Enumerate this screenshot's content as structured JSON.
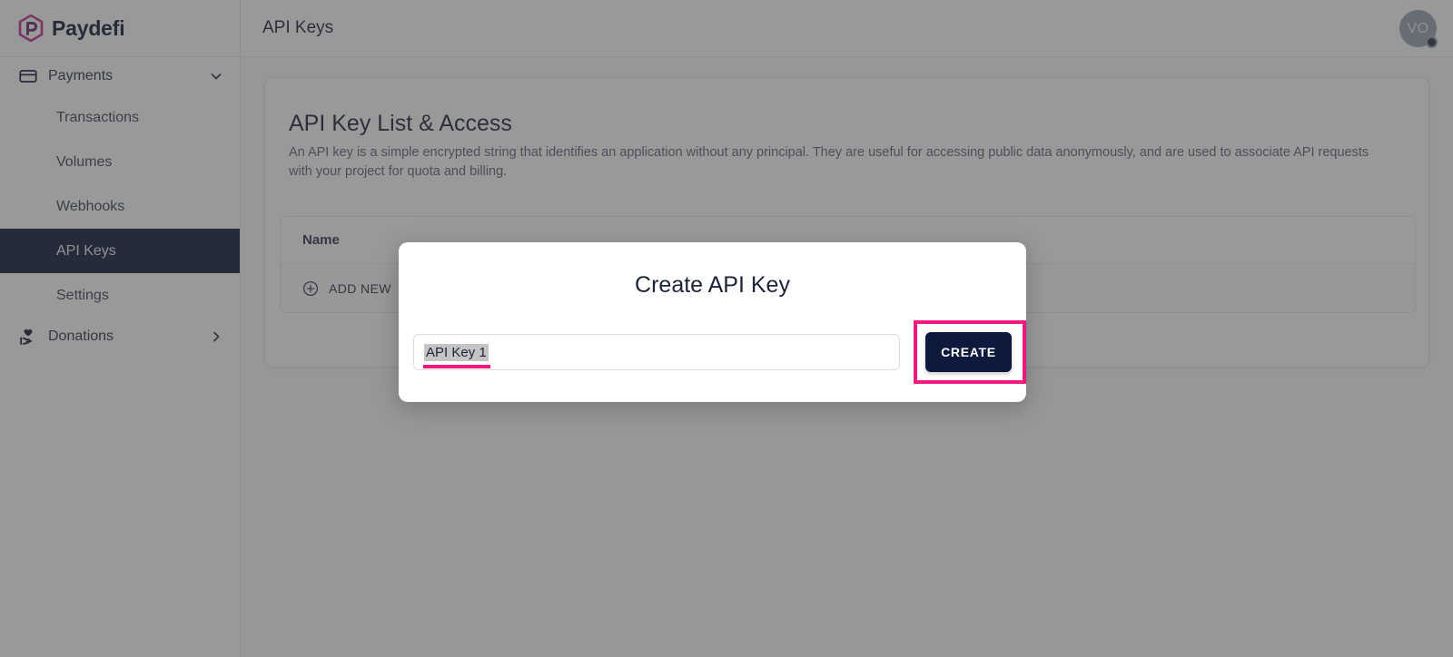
{
  "brand": {
    "name": "Paydefi",
    "logo_icon": "paydefi-hexagon-logo",
    "accent": "#c2308c"
  },
  "sidebar": {
    "group": {
      "label": "Payments",
      "icon": "credit-card-icon",
      "chevron": "chevron-down-icon",
      "expanded": true,
      "items": [
        {
          "label": "Transactions",
          "active": false
        },
        {
          "label": "Volumes",
          "active": false
        },
        {
          "label": "Webhooks",
          "active": false
        },
        {
          "label": "API Keys",
          "active": true
        },
        {
          "label": "Settings",
          "active": false
        }
      ]
    },
    "donations": {
      "label": "Donations",
      "icon": "hand-heart-icon",
      "chevron": "chevron-right-icon",
      "expanded": false
    },
    "active_bg": "#0d1936"
  },
  "header": {
    "title": "API Keys",
    "avatar": {
      "initials": "VO",
      "badge_icon": "status-badge-icon"
    }
  },
  "main": {
    "card": {
      "title": "API Key List & Access",
      "description": "An API key is a simple encrypted string that identifies an application without any principal. They are useful for accessing public data anonymously, and are used to associate API requests with your project for quota and billing."
    },
    "table": {
      "columns": [
        "Name"
      ],
      "add_new": {
        "label": "ADD NEW",
        "icon": "plus-circle-icon"
      }
    }
  },
  "modal": {
    "title": "Create API Key",
    "name_input": {
      "value": "API Key 1",
      "placeholder": "API Key 1",
      "selected": true
    },
    "create_button": {
      "label": "CREATE"
    },
    "highlight_color": "#f5197f"
  }
}
